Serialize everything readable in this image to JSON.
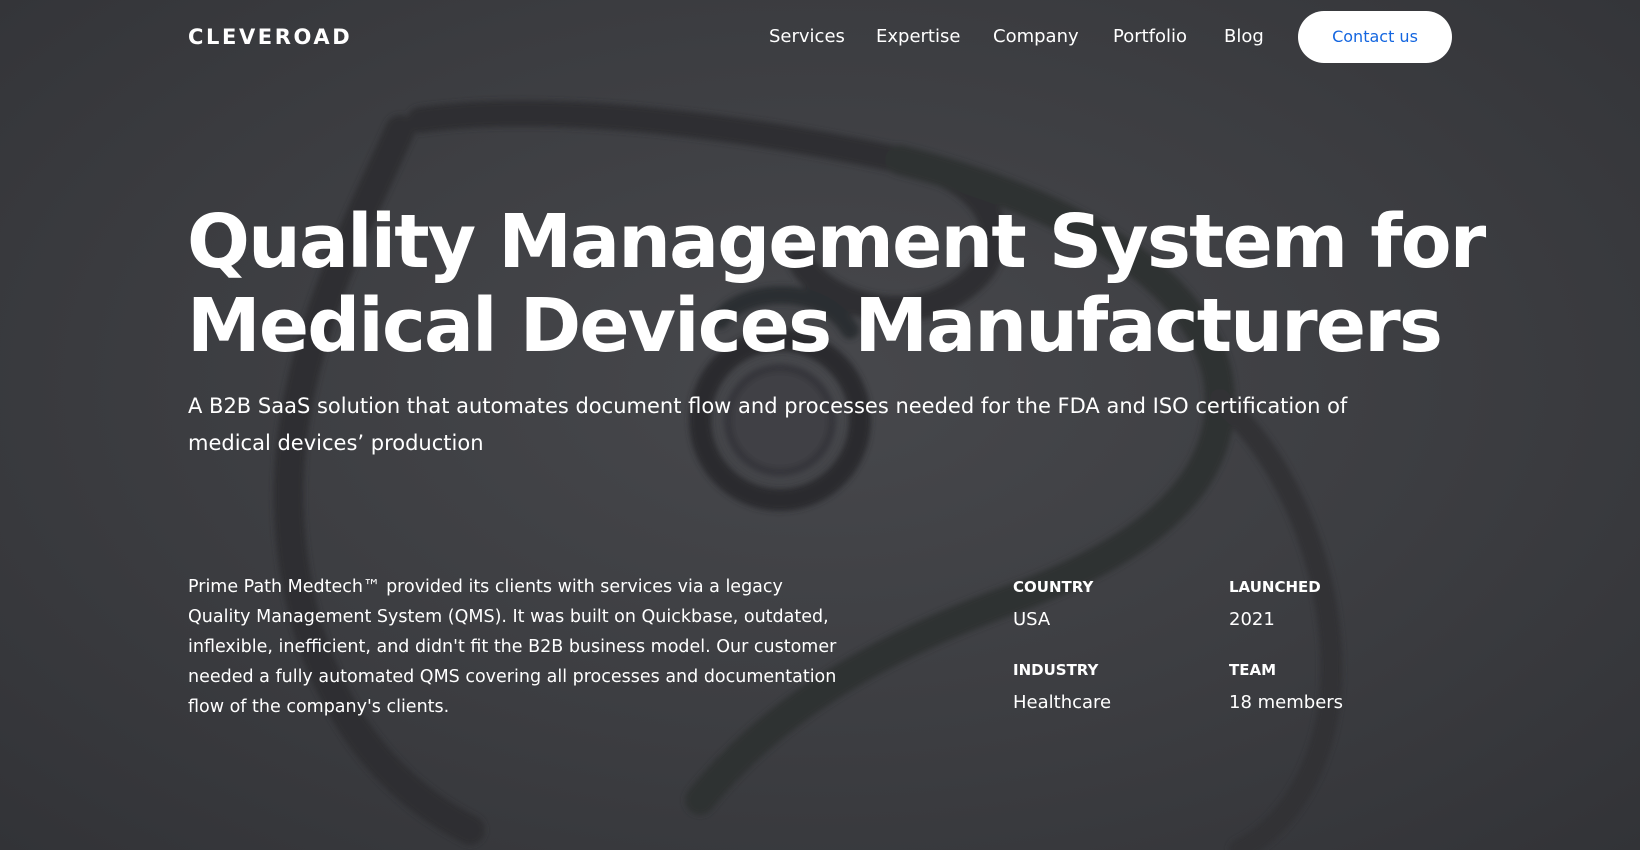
{
  "header": {
    "logo": "CLEVEROAD",
    "nav": [
      {
        "label": "Services"
      },
      {
        "label": "Expertise"
      },
      {
        "label": "Company"
      },
      {
        "label": "Portfolio"
      },
      {
        "label": "Blog"
      }
    ],
    "contact_label": "Contact us"
  },
  "hero": {
    "title_line1": "Quality Management System for",
    "title_line2": "Medical Devices Manufacturers",
    "subtitle": "A B2B SaaS solution that automates document flow and processes needed for the FDA and ISO certification of medical devices’ production",
    "background_image": "stethoscope-image"
  },
  "overview": {
    "description": "Prime Path Medtech™ provided its clients with services via a legacy Quality Management System (QMS). It was built on Quickbase, outdated, inflexible, inefficient, and didn't fit the B2B business model. Our customer needed a fully automated QMS covering all processes and documentation flow of the company's clients.",
    "facts": {
      "country_label": "COUNTRY",
      "country_value": "USA",
      "launched_label": "LAUNCHED",
      "launched_value": "2021",
      "industry_label": "INDUSTRY",
      "industry_value": "Healthcare",
      "team_label": "TEAM",
      "team_value": "18 members"
    }
  },
  "colors": {
    "background": "#3a3b3f",
    "text": "#ffffff",
    "button_background": "#ffffff",
    "button_text": "#1466e0"
  }
}
